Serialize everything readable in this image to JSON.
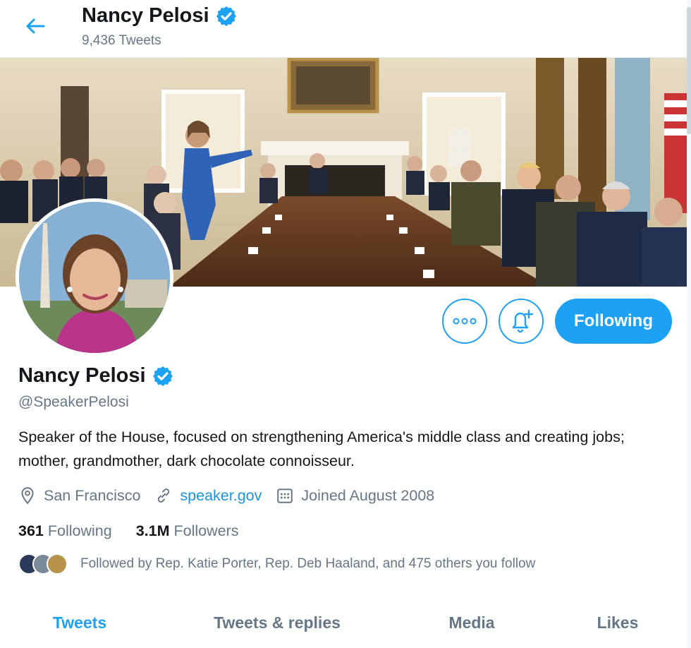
{
  "header": {
    "name": "Nancy Pelosi",
    "tweet_count": "9,436 Tweets"
  },
  "profile": {
    "name": "Nancy Pelosi",
    "handle": "@SpeakerPelosi",
    "bio": "Speaker of the House, focused on strengthening America's middle class and creating jobs; mother, grandmother, dark chocolate connoisseur.",
    "location": "San Francisco",
    "website": "speaker.gov",
    "joined": "Joined August 2008",
    "following_count": "361",
    "following_label": "Following",
    "followers_count": "3.1M",
    "followers_label": "Followers",
    "followed_by": "Followed by Rep. Katie Porter, Rep. Deb Haaland, and 475 others you follow"
  },
  "actions": {
    "follow_label": "Following"
  },
  "tabs": [
    {
      "label": "Tweets",
      "active": true
    },
    {
      "label": "Tweets & replies",
      "active": false
    },
    {
      "label": "Media",
      "active": false
    },
    {
      "label": "Likes",
      "active": false
    }
  ],
  "colors": {
    "accent": "#1da1f2",
    "text": "#14171a",
    "muted": "#657786",
    "link": "#1b95e0"
  },
  "icons": {
    "back": "arrow-left-icon",
    "verified": "verified-badge-icon",
    "more": "more-dots-icon",
    "notify": "bell-plus-icon",
    "location": "location-pin-icon",
    "link": "link-icon",
    "calendar": "calendar-icon"
  }
}
